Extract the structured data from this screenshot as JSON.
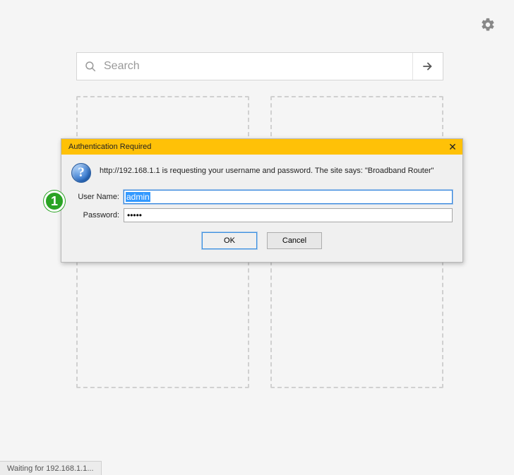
{
  "gear": {
    "name": "settings"
  },
  "search": {
    "placeholder": "Search",
    "value": ""
  },
  "dialog": {
    "title": "Authentication Required",
    "message": "http://192.168.1.1 is requesting your username and password. The site says: \"Broadband Router\"",
    "username_label": "User Name:",
    "username_value": "admin",
    "password_label": "Password:",
    "password_value": "•••••",
    "ok_label": "OK",
    "cancel_label": "Cancel"
  },
  "hint": {
    "number": "1"
  },
  "status": {
    "text": "Waiting for 192.168.1.1..."
  }
}
